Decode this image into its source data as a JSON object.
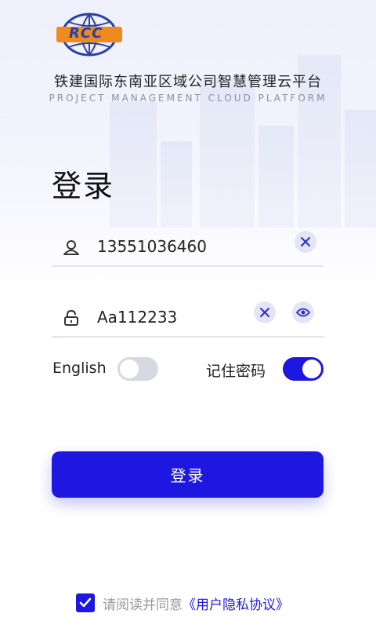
{
  "header": {
    "company_name": "铁建国际东南亚区域公司智慧管理云平台",
    "company_name_en": "PROJECT MANAGEMENT CLOUD PLATFORM",
    "logo_text": "RCC"
  },
  "login": {
    "title": "登录",
    "username": {
      "value": "13551036460",
      "icon": "user-icon",
      "clear_icon": "close-icon"
    },
    "password": {
      "value": "Aa112233",
      "icon": "lock-icon",
      "clear_icon": "close-icon",
      "visibility_icon": "eye-icon"
    },
    "english_label": "English",
    "english_enabled": false,
    "remember_label": "记住密码",
    "remember_enabled": true,
    "submit_label": "登录"
  },
  "agreement": {
    "checked": true,
    "text": "请阅读并同意",
    "link": "《用户隐私协议》"
  },
  "colors": {
    "primary": "#1d17e0",
    "logo_orange": "#f08a1c",
    "logo_blue": "#2740a8"
  }
}
